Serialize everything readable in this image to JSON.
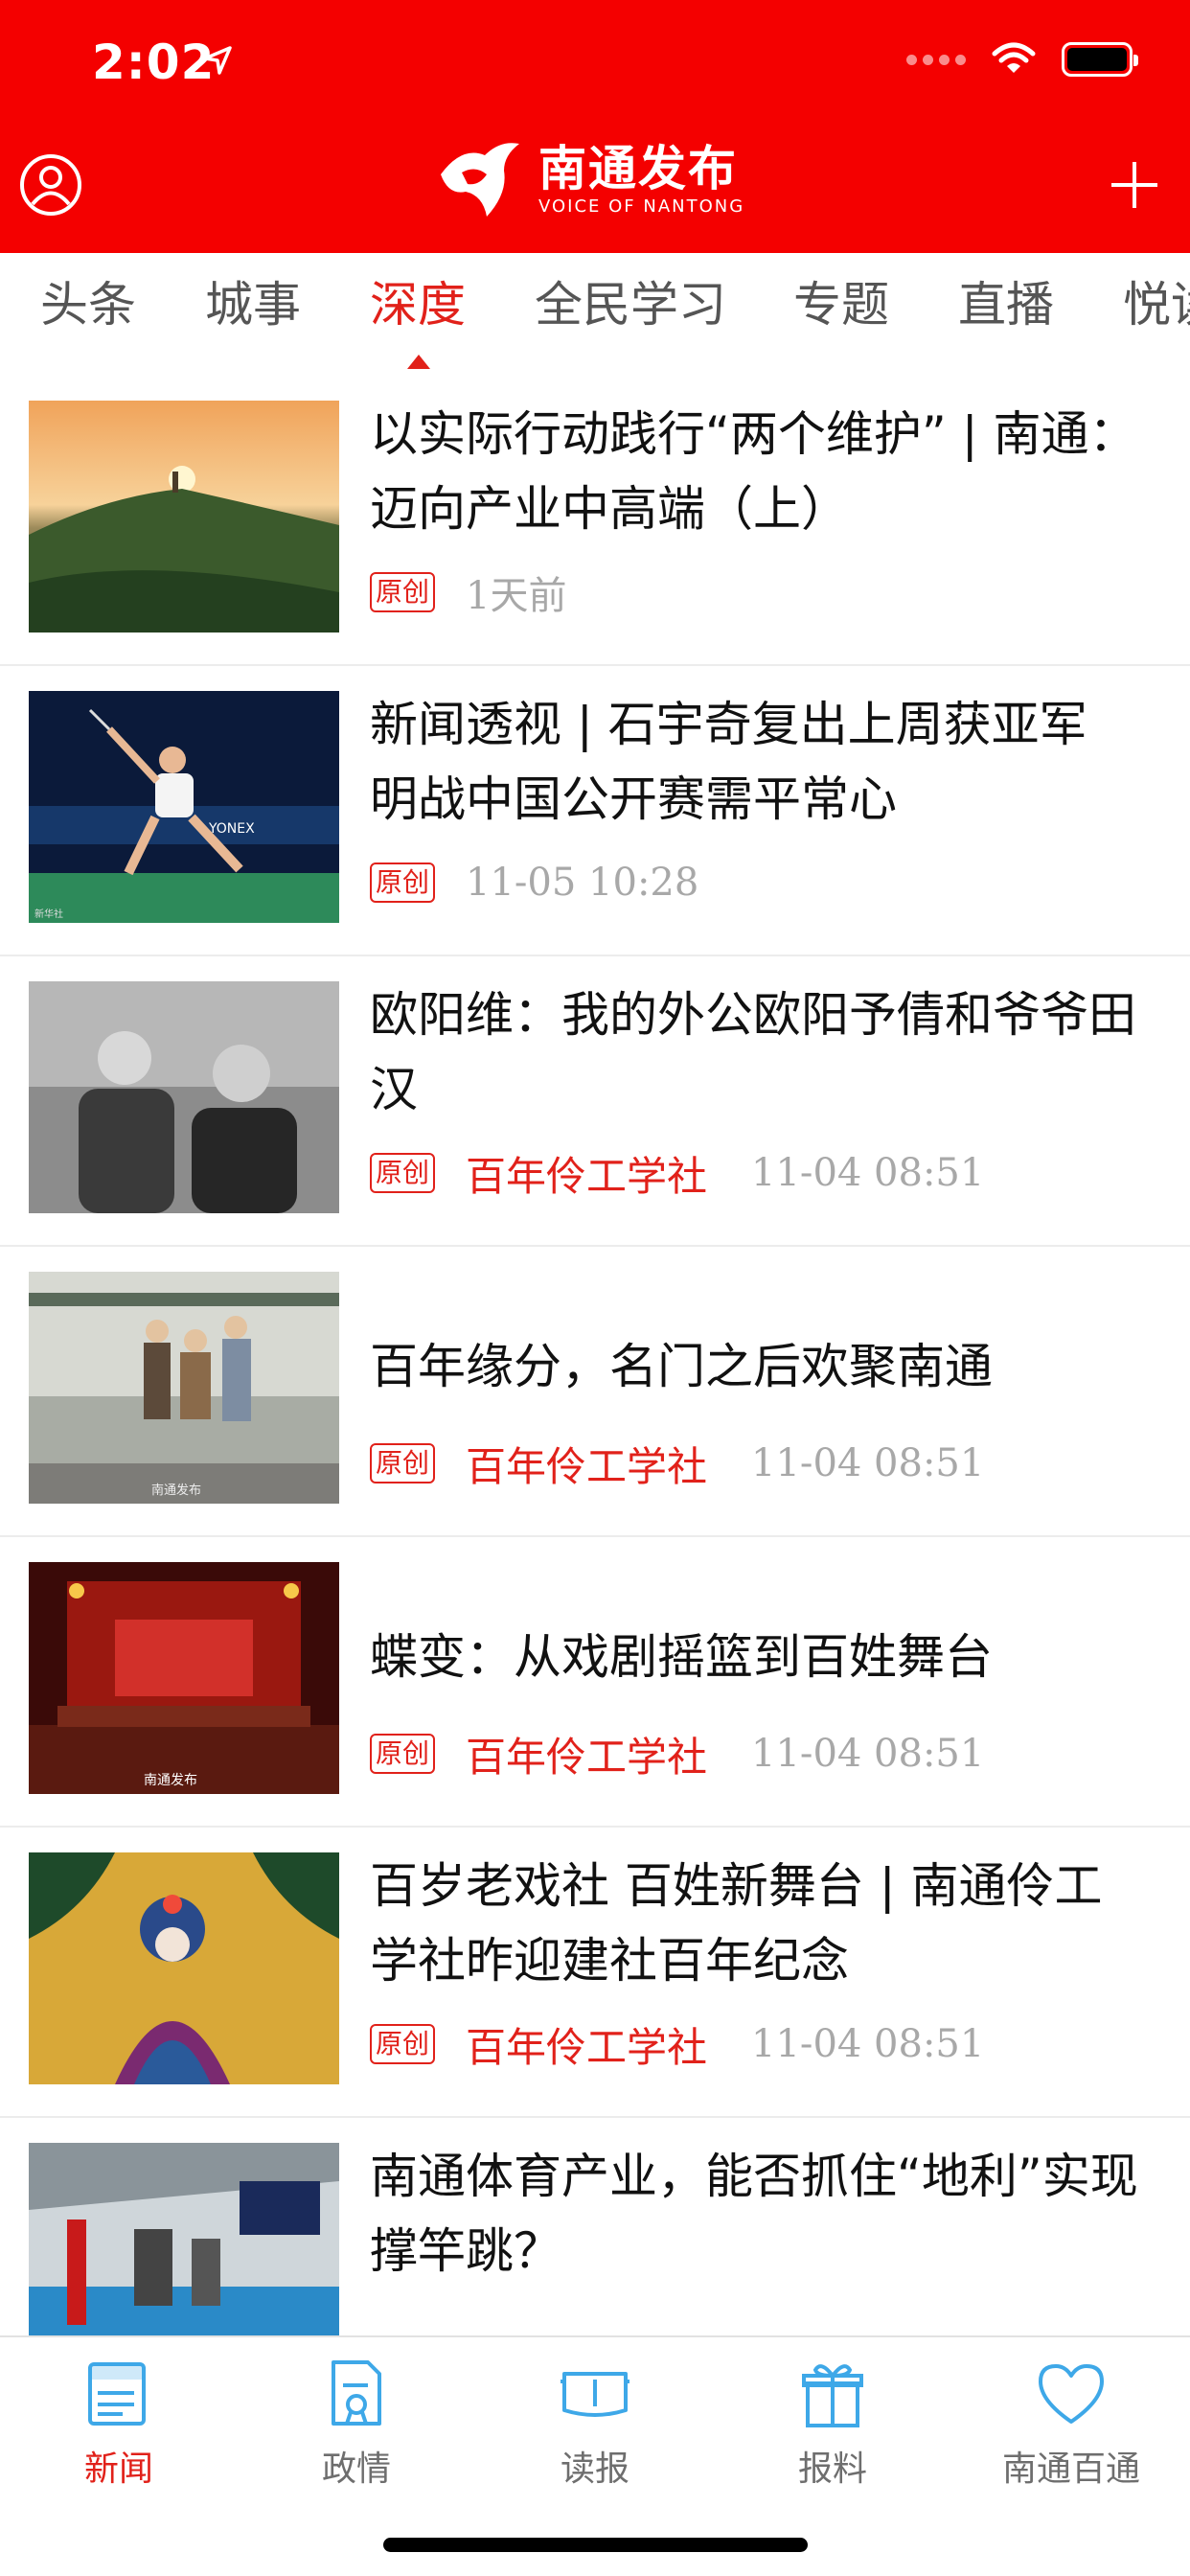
{
  "status_bar": {
    "time": "2:02"
  },
  "header": {
    "logo_cn": "南通发布",
    "logo_en": "VOICE OF NANTONG"
  },
  "tabs": [
    {
      "label": "头条"
    },
    {
      "label": "城事"
    },
    {
      "label": "深度"
    },
    {
      "label": "全民学习"
    },
    {
      "label": "专题"
    },
    {
      "label": "直播"
    },
    {
      "label": "悦读"
    }
  ],
  "active_tab": "深度",
  "news": [
    {
      "title": "以实际行动践行“两个维护” | 南通：迈向产业中高端（上）",
      "badge": "原创",
      "source": "",
      "time": "1天前",
      "thumb": "sunset-landscape"
    },
    {
      "title": "新闻透视 | 石宇奇复出上周获亚军 明战中国公开赛需平常心",
      "badge": "原创",
      "source": "",
      "time": "11-05 10:28",
      "thumb": "badminton-player"
    },
    {
      "title": "欧阳维：我的外公欧阳予倩和爷爷田汉",
      "badge": "原创",
      "source": "百年伶工学社",
      "time": "11-04 08:51",
      "thumb": "old-photo"
    },
    {
      "title": "百年缘分，名门之后欢聚南通",
      "badge": "原创",
      "source": "百年伶工学社",
      "time": "11-04 08:51",
      "thumb": "group-photo"
    },
    {
      "title": "蝶变：从戏剧摇篮到百姓舞台",
      "badge": "原创",
      "source": "百年伶工学社",
      "time": "11-04 08:51",
      "thumb": "stage-photo"
    },
    {
      "title": "百岁老戏社 百姓新舞台 | 南通伶工学社昨迎建社百年纪念",
      "badge": "原创",
      "source": "百年伶工学社",
      "time": "11-04 08:51",
      "thumb": "opera-performer"
    },
    {
      "title": "南通体育产业，能否抓住“地利”实现撑竿跳？",
      "badge": "",
      "source": "",
      "time": "",
      "thumb": "gym-hall"
    }
  ],
  "thumb_watermarks": {
    "group": "南通发布",
    "stage": "南通发布",
    "badminton": "新华社",
    "badminton_brand": "YONEX"
  },
  "bottom_nav": [
    {
      "label": "新闻",
      "icon": "newspaper-icon"
    },
    {
      "label": "政情",
      "icon": "document-icon"
    },
    {
      "label": "读报",
      "icon": "open-paper-icon"
    },
    {
      "label": "报料",
      "icon": "gift-icon"
    },
    {
      "label": "南通百通",
      "icon": "heart-icon"
    }
  ],
  "colors": {
    "brand_red": "#f40000",
    "accent_red": "#e1211a",
    "nav_blue": "#3ea8e8"
  }
}
